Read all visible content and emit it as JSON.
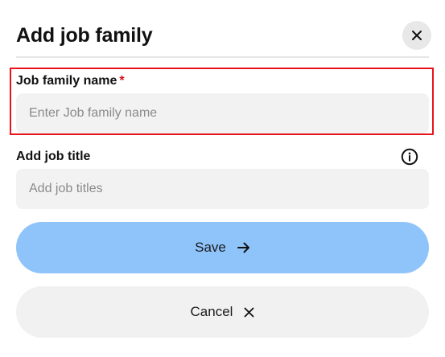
{
  "dialog": {
    "title": "Add job family",
    "close_icon": "close-icon"
  },
  "form": {
    "job_family_name": {
      "label": "Job family name",
      "required_marker": "*",
      "value": "",
      "placeholder": "Enter Job family name"
    },
    "job_title": {
      "label": "Add job title",
      "info_icon": "info-icon",
      "value": "",
      "placeholder": "Add job titles"
    }
  },
  "actions": {
    "save_label": "Save",
    "save_icon": "arrow-right-icon",
    "cancel_label": "Cancel",
    "cancel_icon": "close-icon"
  },
  "colors": {
    "save_button_bg": "#8fc4fb",
    "cancel_button_bg": "#f1f1f1",
    "input_bg": "#f2f2f2",
    "required_marker": "#d6101b",
    "highlight_border": "#e8141b"
  }
}
